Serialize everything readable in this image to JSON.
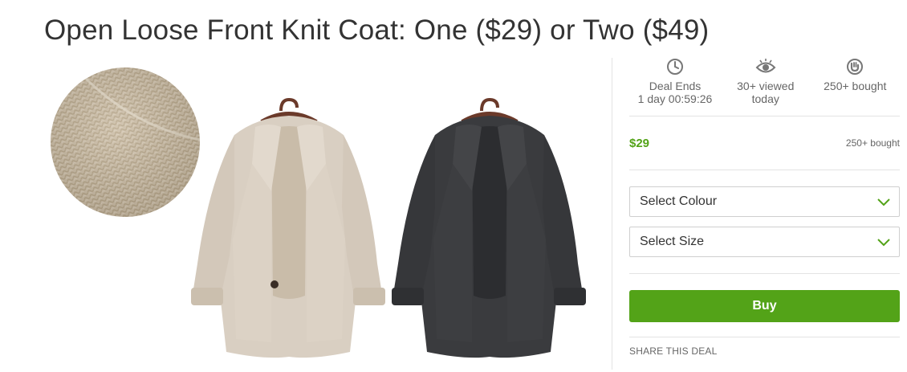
{
  "deal": {
    "title": "Open Loose Front Knit Coat: One ($29) or Two ($49)"
  },
  "gallery": {
    "images": [
      {
        "name": "knit-swatch",
        "color": "#cdbfa8"
      },
      {
        "name": "beige-coat",
        "color": "#d9cfc2"
      },
      {
        "name": "charcoal-coat",
        "color": "#3a3b3e"
      }
    ]
  },
  "stats": [
    {
      "icon": "clock-icon",
      "line1": "Deal Ends",
      "line2": "1 day 00:59:26"
    },
    {
      "icon": "eye-icon",
      "line1": "30+ viewed",
      "line2": "today"
    },
    {
      "icon": "bought-icon",
      "line1": "250+ bought",
      "line2": ""
    }
  ],
  "price": {
    "value": "$29",
    "bought": "250+ bought"
  },
  "options": {
    "colour_label": "Select Colour",
    "size_label": "Select Size"
  },
  "buy_label": "Buy",
  "share_label": "SHARE THIS DEAL",
  "colors": {
    "accent": "#53a318",
    "divider": "#e3e3e3",
    "text": "#333333"
  }
}
